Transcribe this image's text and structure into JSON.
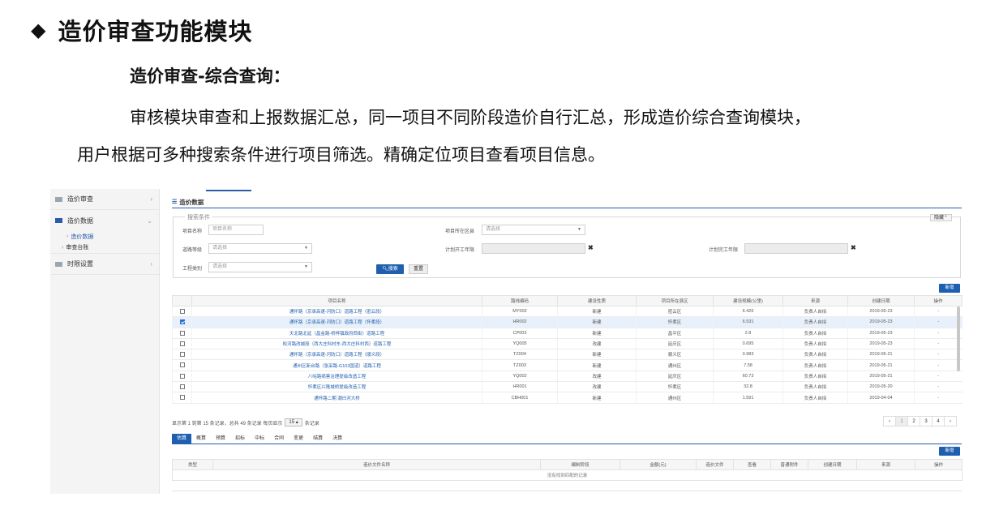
{
  "slide": {
    "title": "造价审查功能模块",
    "subtitle": "造价审查-综合查询：",
    "paragraph_line1": "审核模块审查和上报数据汇总，同一项目不同阶段造价自行汇总，形成造价综合查询模块，",
    "paragraph_line2": "用户根据可多种搜索条件进行项目筛选。精确定位项目查看项目信息。"
  },
  "sidebar": {
    "items": [
      {
        "label": "造价审查"
      },
      {
        "label": "造价数据"
      },
      {
        "label": "时限设置"
      }
    ],
    "sub_items": [
      {
        "label": "造价数据"
      },
      {
        "label": "审查台账"
      }
    ]
  },
  "header": {
    "title": "造价数据"
  },
  "search": {
    "legend": "搜索条件",
    "hide_label": "隐藏",
    "project_name_label": "项目名称",
    "project_name_placeholder": "项目名称",
    "district_label": "项目所在区县",
    "district_placeholder": "请选择",
    "road_grade_label": "道路等级",
    "road_grade_placeholder": "请选择",
    "start_label": "计划开工年限",
    "finish_label": "计划完工年限",
    "type_label": "工程类别",
    "type_placeholder": "请选择",
    "search_button": "搜索",
    "reset_button": "重置"
  },
  "new_button": "新增",
  "table": {
    "columns": [
      "项目名称",
      "路线编码",
      "建设性质",
      "项目所在县区",
      "建设规模(公里)",
      "来源",
      "创建日期",
      "操作"
    ],
    "rows": [
      {
        "checked": false,
        "selected": false,
        "name": "通怀路（京承高速-河防口）道路工程（密云段）",
        "code": "MY002",
        "nature": "新建",
        "district": "密云区",
        "scale": "6.426",
        "source": "负责人自拟",
        "date": "2019-05-23",
        "op": "-"
      },
      {
        "checked": true,
        "selected": true,
        "name": "通怀路（京承高速-河防口）道路工程（怀柔段）",
        "code": "HR002",
        "nature": "新建",
        "district": "怀柔区",
        "scale": "6.531",
        "source": "负责人自拟",
        "date": "2019-05-23",
        "op": "-"
      },
      {
        "checked": false,
        "selected": false,
        "name": "天北路北延（昌金路-桥梓镇政府西街）道路工程",
        "code": "CP003",
        "nature": "新建",
        "district": "昌平区",
        "scale": "2.8",
        "source": "负责人自拟",
        "date": "2019-05-23",
        "op": "-"
      },
      {
        "checked": false,
        "selected": false,
        "name": "松河路改城段（西大庄科村东-西大庄科村西）道路工程",
        "code": "YQ005",
        "nature": "改建",
        "district": "延庆区",
        "scale": "0.695",
        "source": "负责人自拟",
        "date": "2019-05-23",
        "op": "-"
      },
      {
        "checked": false,
        "selected": false,
        "name": "通怀路（京承高速-河防口）道路工程（顺义段）",
        "code": "TZ004",
        "nature": "新建",
        "district": "顺义区",
        "scale": "0.983",
        "source": "负责人自拟",
        "date": "2019-05-21",
        "op": "-"
      },
      {
        "checked": false,
        "selected": false,
        "name": "通州区新台路（张采路-G103国道）道路工程",
        "code": "TZ003",
        "nature": "新建",
        "district": "通州区",
        "scale": "7.58",
        "source": "负责人自拟",
        "date": "2019-05-21",
        "op": "-"
      },
      {
        "checked": false,
        "selected": false,
        "name": "八峪路病害治理提级改造工程",
        "code": "YQ002",
        "nature": "改建",
        "district": "延庆区",
        "scale": "60.73",
        "source": "负责人自拟",
        "date": "2019-05-21",
        "op": "-"
      },
      {
        "checked": false,
        "selected": false,
        "name": "怀柔区兴隆城桥提级改造工程",
        "code": "HR001",
        "nature": "改建",
        "district": "怀柔区",
        "scale": "32.8",
        "source": "负责人自拟",
        "date": "2019-05-20",
        "op": "-"
      },
      {
        "checked": false,
        "selected": false,
        "name": "通怀路二期 潮白河大桥",
        "code": "CBH001",
        "nature": "新建",
        "district": "通州区",
        "scale": "1.591",
        "source": "负责人自拟",
        "date": "2019-04-04",
        "op": "-"
      }
    ]
  },
  "pagination": {
    "info_prefix": "显示第 1 到第 15 条记录，总共 49 条记录 每页显示",
    "page_size": "15 ▴",
    "info_suffix": "条记录",
    "pages": [
      "‹",
      "1",
      "2",
      "3",
      "4",
      "›"
    ],
    "current_page": "1"
  },
  "bottom_tabs": [
    "估算",
    "概算",
    "预算",
    "招标",
    "中标",
    "合同",
    "变更",
    "结算",
    "决算"
  ],
  "bottom_table": {
    "columns": [
      "类型",
      "造价文件名称",
      "编制阶段",
      "金额(元)",
      "造价文件",
      "查看",
      "普通附件",
      "创建日期",
      "来源",
      "操作"
    ],
    "empty_text": "没有找到匹配的记录"
  }
}
